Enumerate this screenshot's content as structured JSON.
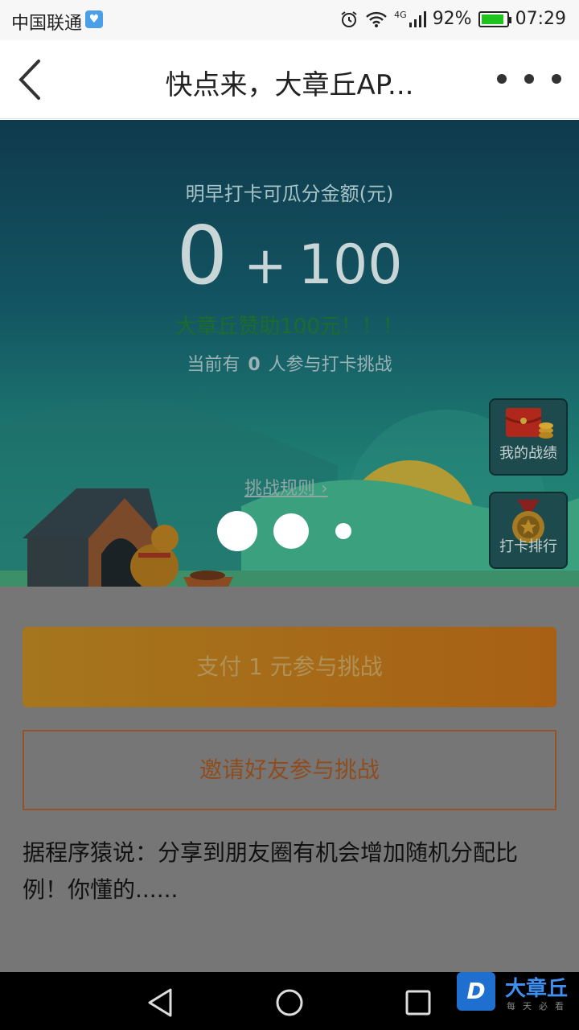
{
  "status_bar": {
    "carrier": "中国联通",
    "battery_percent": "92%",
    "time": "07:29",
    "network": "4G"
  },
  "header": {
    "title": "快点来，大章丘AP..."
  },
  "hero": {
    "amount_label": "明早打卡可瓜分金额(元)",
    "amount_current": "0",
    "amount_plus": "+",
    "amount_bonus": "100",
    "sponsor_text": "大章丘赞助100元！！！",
    "participants_prefix": "当前有",
    "participants_count": "0",
    "participants_suffix": "人参与打卡挑战",
    "rules_link": "挑战规则"
  },
  "side_buttons": {
    "my_record": "我的战绩",
    "ranking": "打卡排行"
  },
  "actions": {
    "pay_button": "支付 1 元参与挑战",
    "invite_button": "邀请好友参与挑战"
  },
  "tip_text": "据程序猿说：分享到朋友圈有机会增加随机分配比例！你懂的......",
  "brand": {
    "logo_letter": "D",
    "name": "大章丘",
    "slogan": "每天必看"
  },
  "colors": {
    "hero_top": "#0f3a4d",
    "hero_bottom": "#2a8f7a",
    "pay_button": "#a86a18",
    "invite_border": "#94512a",
    "overlay_gray": "#767676"
  }
}
